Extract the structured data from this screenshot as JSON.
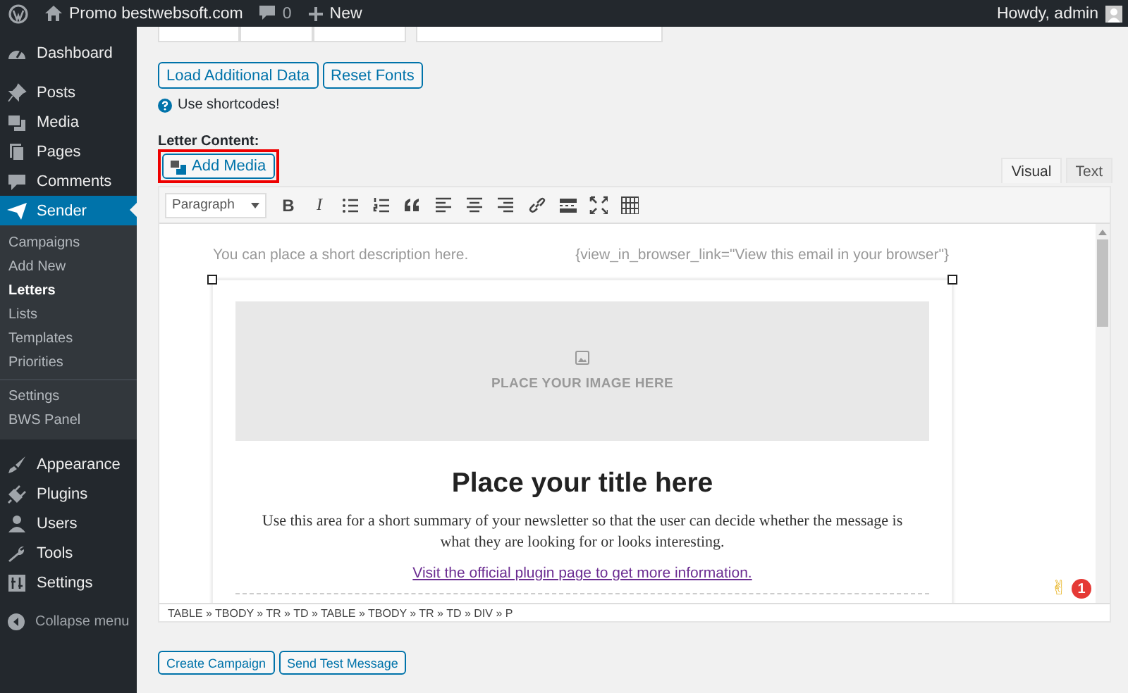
{
  "admin_bar": {
    "site": "Promo bestwebsoft.com",
    "comments": "0",
    "new": "New",
    "greeting": "Howdy, admin"
  },
  "sidebar": {
    "groups": [
      {
        "items": [
          {
            "label": "Dashboard",
            "selected": false
          }
        ]
      },
      {
        "items": [
          {
            "label": "Posts",
            "selected": false
          },
          {
            "label": "Media",
            "selected": false
          },
          {
            "label": "Pages",
            "selected": false
          },
          {
            "label": "Comments",
            "selected": false
          },
          {
            "label": "Sender",
            "selected": true,
            "submenu": [
              {
                "items": [
                  {
                    "label": "Campaigns",
                    "selected": false
                  },
                  {
                    "label": "Add New",
                    "selected": false
                  },
                  {
                    "label": "Letters",
                    "selected": true
                  },
                  {
                    "label": "Lists",
                    "selected": false
                  },
                  {
                    "label": "Templates",
                    "selected": false
                  },
                  {
                    "label": "Priorities",
                    "selected": false
                  }
                ]
              },
              {
                "items": [
                  {
                    "label": "Settings",
                    "selected": false
                  },
                  {
                    "label": "BWS Panel",
                    "selected": false
                  }
                ]
              }
            ]
          }
        ]
      },
      {
        "items": [
          {
            "label": "Appearance",
            "selected": false
          },
          {
            "label": "Plugins",
            "selected": false
          },
          {
            "label": "Users",
            "selected": false
          },
          {
            "label": "Tools",
            "selected": false
          },
          {
            "label": "Settings",
            "selected": false
          }
        ]
      }
    ],
    "collapse": "Collapse menu"
  },
  "content": {
    "top_buttons": [
      "Load Additional Data",
      "Reset Fonts"
    ],
    "hint": "Use shortcodes!",
    "section_label": "Letter Content:",
    "add_media": {
      "label": "Add Media",
      "highlighted": true
    },
    "editor_tabs": [
      {
        "label": "Visual",
        "selected": true
      },
      {
        "label": "Text",
        "selected": false
      }
    ],
    "toolbar": {
      "format": "Paragraph",
      "buttons": [
        {
          "kind": "bold",
          "label": "B"
        },
        {
          "kind": "italic",
          "label": "I"
        },
        {
          "kind": "bullets"
        },
        {
          "kind": "numbers"
        },
        {
          "kind": "quote"
        },
        {
          "kind": "align-left"
        },
        {
          "kind": "align-center"
        },
        {
          "kind": "align-right"
        },
        {
          "kind": "link"
        },
        {
          "kind": "more"
        },
        {
          "kind": "fullscreen"
        },
        {
          "kind": "toolbar"
        }
      ]
    },
    "document": {
      "description": "You can place a short description here.",
      "browser_link": "{view_in_browser_link=\"View this email in your browser\"}",
      "image_placeholder": "PLACE YOUR IMAGE HERE",
      "title": "Place your title here",
      "summary": "Use this area for a short summary of your newsletter so that the user can decide whether the message is what they are looking for or looks interesting.",
      "link": "Visit the official plugin page to get more information."
    },
    "emoji": "✌",
    "badge": "1",
    "path": "TABLE » TBODY » TR » TD » TABLE » TBODY » TR » TD » DIV » P",
    "bottom_buttons": [
      "Create Campaign",
      "Send Test Message"
    ]
  }
}
